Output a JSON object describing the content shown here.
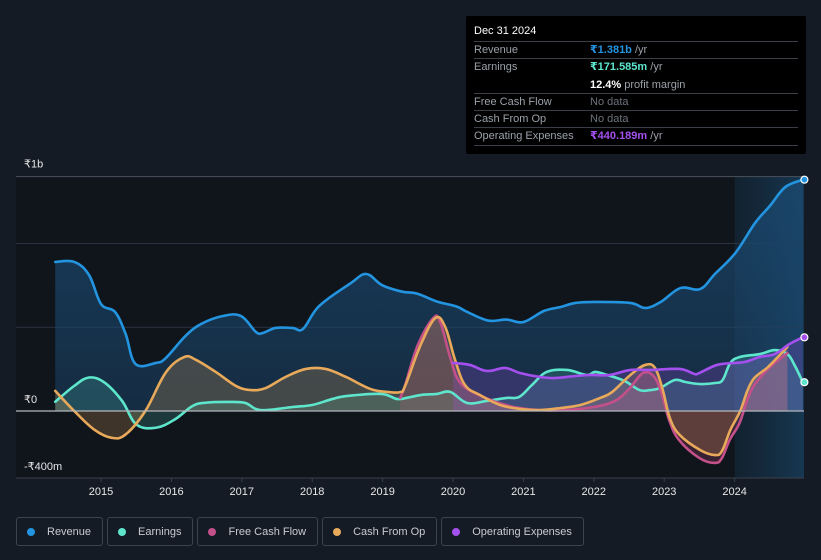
{
  "tooltip": {
    "date": "Dec 31 2024",
    "rows": [
      {
        "label": "Revenue",
        "value": "₹1.381b",
        "unit": " /yr",
        "color": "#2394df"
      },
      {
        "label": "Earnings",
        "value": "₹171.585m",
        "unit": " /yr",
        "color": "#5ee6cd"
      },
      {
        "label": "",
        "value": "12.4%",
        "unit": " profit margin",
        "color": "#ffffff"
      },
      {
        "label": "Free Cash Flow",
        "value": "No data",
        "unit": "",
        "color": "#6d737b"
      },
      {
        "label": "Cash From Op",
        "value": "No data",
        "unit": "",
        "color": "#6d737b"
      },
      {
        "label": "Operating Expenses",
        "value": "₹440.189m",
        "unit": " /yr",
        "color": "#a450ee"
      }
    ]
  },
  "legend": [
    {
      "label": "Revenue",
      "color": "#2394df"
    },
    {
      "label": "Earnings",
      "color": "#5ee6cd"
    },
    {
      "label": "Free Cash Flow",
      "color": "#c4508a"
    },
    {
      "label": "Cash From Op",
      "color": "#e8aa5a"
    },
    {
      "label": "Operating Expenses",
      "color": "#a450ee"
    }
  ],
  "chart_data": {
    "type": "area",
    "title": "",
    "xlabel": "",
    "ylabel": "",
    "units": "₹m",
    "ylim": [
      -400,
      1400
    ],
    "xlim": [
      2014.35,
      2025.0
    ],
    "y_tick_labels": [
      {
        "value": 1000,
        "label": "₹1b"
      },
      {
        "value": 0,
        "label": "₹0"
      },
      {
        "value": -400,
        "label": "-₹400m"
      }
    ],
    "gridlines": [
      1400,
      1000,
      500,
      0
    ],
    "x_ticks": [
      2015,
      2016,
      2017,
      2018,
      2019,
      2020,
      2021,
      2022,
      2023,
      2024
    ],
    "highlight_from": 2024.0,
    "grid": true,
    "legend_position": "bottom",
    "series": [
      {
        "name": "Revenue",
        "color": "#2394df",
        "points": [
          [
            2014.35,
            890
          ],
          [
            2014.62,
            890
          ],
          [
            2014.83,
            812
          ],
          [
            2015.0,
            639
          ],
          [
            2015.2,
            591
          ],
          [
            2015.35,
            460
          ],
          [
            2015.49,
            281
          ],
          [
            2015.78,
            287
          ],
          [
            2015.92,
            316
          ],
          [
            2016.2,
            448
          ],
          [
            2016.42,
            519
          ],
          [
            2016.73,
            567
          ],
          [
            2016.99,
            567
          ],
          [
            2017.2,
            472
          ],
          [
            2017.3,
            466
          ],
          [
            2017.48,
            496
          ],
          [
            2017.72,
            496
          ],
          [
            2017.87,
            490
          ],
          [
            2018.1,
            627
          ],
          [
            2018.55,
            764
          ],
          [
            2018.77,
            818
          ],
          [
            2018.99,
            752
          ],
          [
            2019.27,
            713
          ],
          [
            2019.49,
            701
          ],
          [
            2019.77,
            654
          ],
          [
            2020.05,
            624
          ],
          [
            2020.19,
            594
          ],
          [
            2020.5,
            540
          ],
          [
            2020.76,
            546
          ],
          [
            2021.0,
            531
          ],
          [
            2021.29,
            597
          ],
          [
            2021.53,
            621
          ],
          [
            2021.74,
            645
          ],
          [
            2022.02,
            651
          ],
          [
            2022.52,
            645
          ],
          [
            2022.73,
            615
          ],
          [
            2022.95,
            651
          ],
          [
            2023.23,
            734
          ],
          [
            2023.51,
            728
          ],
          [
            2023.72,
            818
          ],
          [
            2024.01,
            943
          ],
          [
            2024.29,
            1122
          ],
          [
            2024.5,
            1224
          ],
          [
            2024.72,
            1337
          ],
          [
            2024.97,
            1381
          ]
        ]
      },
      {
        "name": "Earnings",
        "color": "#5ee6cd",
        "points": [
          [
            2014.35,
            55
          ],
          [
            2014.62,
            150
          ],
          [
            2014.83,
            200
          ],
          [
            2015.05,
            170
          ],
          [
            2015.3,
            60
          ],
          [
            2015.5,
            -80
          ],
          [
            2015.78,
            -100
          ],
          [
            2016.05,
            -50
          ],
          [
            2016.3,
            30
          ],
          [
            2016.5,
            50
          ],
          [
            2016.83,
            54
          ],
          [
            2017.05,
            48
          ],
          [
            2017.2,
            12
          ],
          [
            2017.36,
            6
          ],
          [
            2017.72,
            24
          ],
          [
            2018.0,
            36
          ],
          [
            2018.29,
            72
          ],
          [
            2018.5,
            90
          ],
          [
            2018.98,
            102
          ],
          [
            2019.2,
            72
          ],
          [
            2019.34,
            78
          ],
          [
            2019.55,
            96
          ],
          [
            2019.77,
            102
          ],
          [
            2019.96,
            114
          ],
          [
            2020.2,
            48
          ],
          [
            2020.48,
            60
          ],
          [
            2020.76,
            78
          ],
          [
            2020.94,
            84
          ],
          [
            2021.12,
            155
          ],
          [
            2021.33,
            233
          ],
          [
            2021.62,
            245
          ],
          [
            2021.9,
            215
          ],
          [
            2022.02,
            233
          ],
          [
            2022.19,
            215
          ],
          [
            2022.44,
            179
          ],
          [
            2022.65,
            125
          ],
          [
            2022.8,
            125
          ],
          [
            2022.94,
            137
          ],
          [
            2023.15,
            185
          ],
          [
            2023.3,
            173
          ],
          [
            2023.51,
            161
          ],
          [
            2023.72,
            167
          ],
          [
            2023.83,
            185
          ],
          [
            2023.94,
            287
          ],
          [
            2024.08,
            323
          ],
          [
            2024.36,
            340
          ],
          [
            2024.57,
            364
          ],
          [
            2024.75,
            340
          ],
          [
            2024.85,
            275
          ],
          [
            2024.97,
            172
          ]
        ]
      },
      {
        "name": "Free Cash Flow",
        "color": "#c4508a",
        "points": [
          [
            2019.25,
            78
          ],
          [
            2019.32,
            155
          ],
          [
            2019.5,
            394
          ],
          [
            2019.72,
            555
          ],
          [
            2019.82,
            530
          ],
          [
            2019.96,
            320
          ],
          [
            2020.1,
            170
          ],
          [
            2020.4,
            90
          ],
          [
            2020.8,
            30
          ],
          [
            2021.2,
            6
          ],
          [
            2021.6,
            6
          ],
          [
            2022.0,
            24
          ],
          [
            2022.3,
            60
          ],
          [
            2022.5,
            131
          ],
          [
            2022.7,
            227
          ],
          [
            2022.86,
            203
          ],
          [
            2022.97,
            95
          ],
          [
            2023.07,
            -54
          ],
          [
            2023.21,
            -173
          ],
          [
            2023.5,
            -281
          ],
          [
            2023.72,
            -310
          ],
          [
            2023.82,
            -281
          ],
          [
            2023.93,
            -173
          ],
          [
            2024.07,
            -72
          ],
          [
            2024.18,
            66
          ],
          [
            2024.28,
            155
          ],
          [
            2024.49,
            257
          ],
          [
            2024.75,
            346
          ]
        ]
      },
      {
        "name": "Cash From Op",
        "color": "#e8aa5a",
        "points": [
          [
            2014.35,
            120
          ],
          [
            2014.62,
            0
          ],
          [
            2014.9,
            -110
          ],
          [
            2015.15,
            -160
          ],
          [
            2015.35,
            -140
          ],
          [
            2015.63,
            0
          ],
          [
            2015.92,
            230
          ],
          [
            2016.18,
            322
          ],
          [
            2016.35,
            305
          ],
          [
            2016.63,
            233
          ],
          [
            2016.92,
            149
          ],
          [
            2017.13,
            125
          ],
          [
            2017.34,
            137
          ],
          [
            2017.62,
            203
          ],
          [
            2017.91,
            251
          ],
          [
            2018.19,
            251
          ],
          [
            2018.48,
            203
          ],
          [
            2018.83,
            131
          ],
          [
            2019.09,
            113
          ],
          [
            2019.25,
            113
          ],
          [
            2019.32,
            149
          ],
          [
            2019.54,
            394
          ],
          [
            2019.75,
            555
          ],
          [
            2019.89,
            501
          ],
          [
            2020.03,
            304
          ],
          [
            2020.17,
            155
          ],
          [
            2020.38,
            96
          ],
          [
            2020.67,
            36
          ],
          [
            2020.96,
            12
          ],
          [
            2021.24,
            6
          ],
          [
            2021.53,
            18
          ],
          [
            2021.81,
            36
          ],
          [
            2022.09,
            78
          ],
          [
            2022.26,
            113
          ],
          [
            2022.52,
            215
          ],
          [
            2022.73,
            275
          ],
          [
            2022.87,
            257
          ],
          [
            2022.98,
            125
          ],
          [
            2023.08,
            -42
          ],
          [
            2023.22,
            -143
          ],
          [
            2023.51,
            -233
          ],
          [
            2023.72,
            -263
          ],
          [
            2023.82,
            -239
          ],
          [
            2023.94,
            -113
          ],
          [
            2024.08,
            0
          ],
          [
            2024.18,
            119
          ],
          [
            2024.28,
            197
          ],
          [
            2024.46,
            257
          ],
          [
            2024.6,
            316
          ],
          [
            2024.75,
            382
          ]
        ]
      },
      {
        "name": "Operating Expenses",
        "color": "#a450ee",
        "points": [
          [
            2020.0,
            287
          ],
          [
            2020.24,
            275
          ],
          [
            2020.48,
            239
          ],
          [
            2020.74,
            257
          ],
          [
            2020.95,
            227
          ],
          [
            2021.24,
            203
          ],
          [
            2021.45,
            197
          ],
          [
            2021.74,
            209
          ],
          [
            2021.95,
            215
          ],
          [
            2022.22,
            215
          ],
          [
            2022.52,
            245
          ],
          [
            2022.8,
            245
          ],
          [
            2023.22,
            251
          ],
          [
            2023.43,
            221
          ],
          [
            2023.5,
            227
          ],
          [
            2023.75,
            275
          ],
          [
            2024.0,
            287
          ],
          [
            2024.15,
            293
          ],
          [
            2024.36,
            323
          ],
          [
            2024.57,
            340
          ],
          [
            2024.78,
            400
          ],
          [
            2024.97,
            440
          ]
        ]
      }
    ]
  }
}
